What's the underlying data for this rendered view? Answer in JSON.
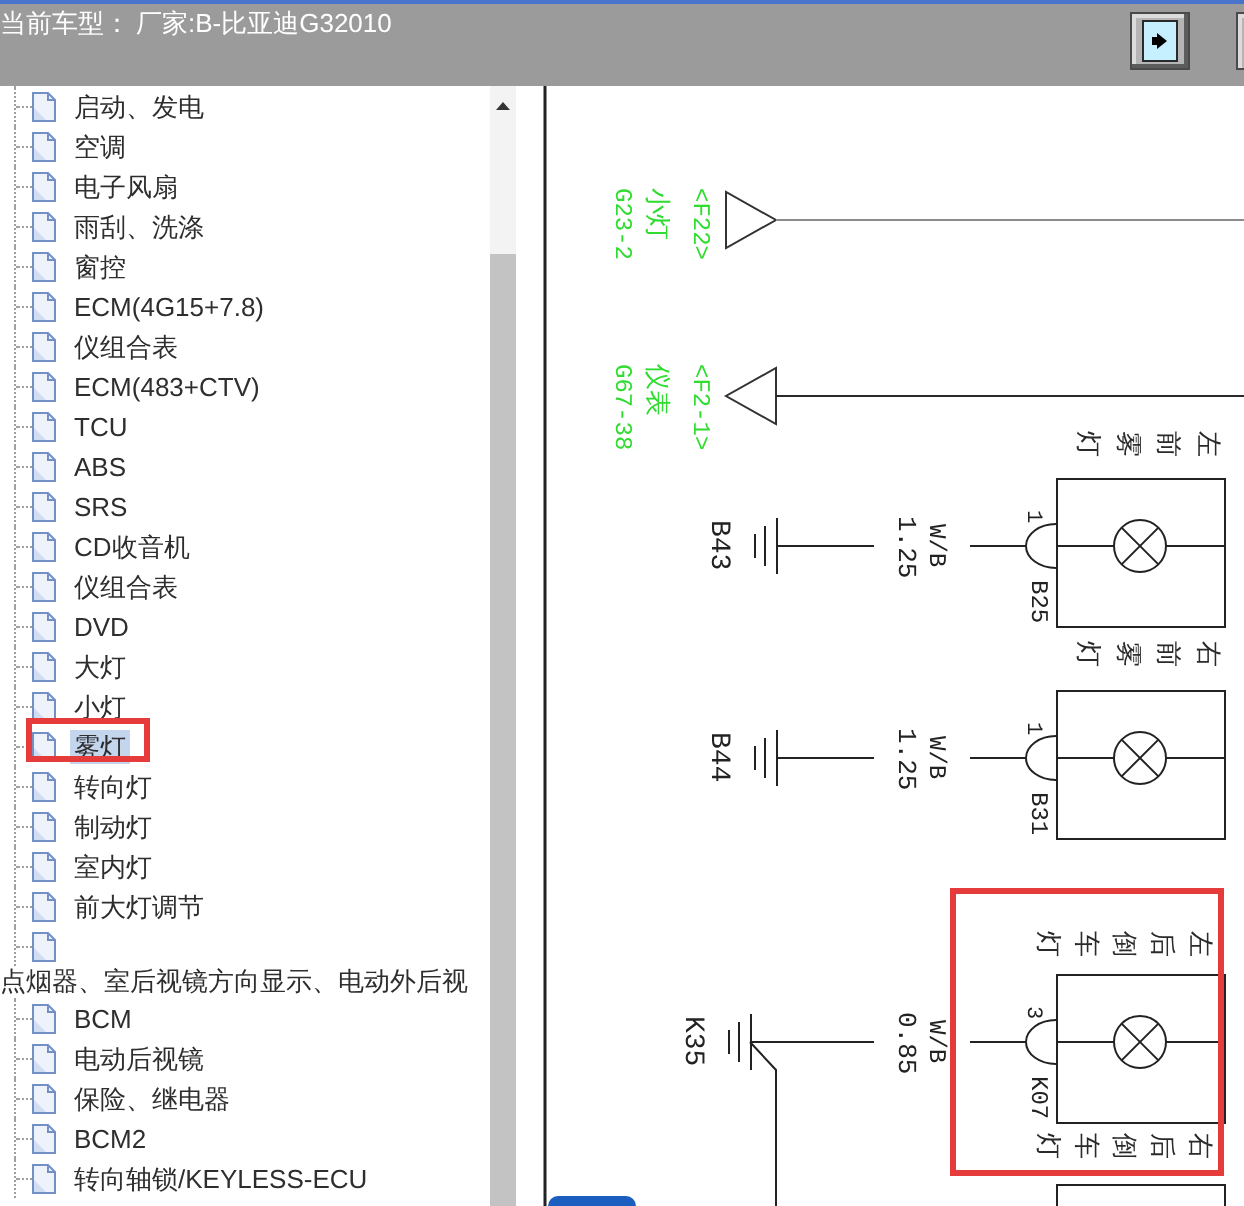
{
  "header": {
    "label": "当前车型：",
    "value": "厂家:B-比亚迪G32010"
  },
  "tree": {
    "items": [
      {
        "kind": "leaf",
        "label": "启动、发电",
        "selected": false,
        "marked": false
      },
      {
        "kind": "leaf",
        "label": "空调",
        "selected": false,
        "marked": false
      },
      {
        "kind": "leaf",
        "label": "电子风扇",
        "selected": false,
        "marked": false
      },
      {
        "kind": "leaf",
        "label": "雨刮、洗涤",
        "selected": false,
        "marked": false
      },
      {
        "kind": "leaf",
        "label": "窗控",
        "selected": false,
        "marked": false
      },
      {
        "kind": "leaf",
        "label": "ECM(4G15+7.8)",
        "selected": false,
        "marked": false
      },
      {
        "kind": "leaf",
        "label": "仪组合表",
        "selected": false,
        "marked": false
      },
      {
        "kind": "leaf",
        "label": "ECM(483+CTV)",
        "selected": false,
        "marked": false
      },
      {
        "kind": "leaf",
        "label": "TCU",
        "selected": false,
        "marked": false
      },
      {
        "kind": "leaf",
        "label": "ABS",
        "selected": false,
        "marked": false
      },
      {
        "kind": "leaf",
        "label": "SRS",
        "selected": false,
        "marked": false
      },
      {
        "kind": "leaf",
        "label": "CD收音机",
        "selected": false,
        "marked": false
      },
      {
        "kind": "leaf",
        "label": "仪组合表",
        "selected": false,
        "marked": false
      },
      {
        "kind": "leaf",
        "label": "DVD",
        "selected": false,
        "marked": false
      },
      {
        "kind": "leaf",
        "label": "大灯",
        "selected": false,
        "marked": false
      },
      {
        "kind": "leaf",
        "label": "小灯",
        "selected": false,
        "marked": false
      },
      {
        "kind": "leaf",
        "label": "雾灯",
        "selected": true,
        "marked": true
      },
      {
        "kind": "leaf",
        "label": "转向灯",
        "selected": false,
        "marked": false
      },
      {
        "kind": "leaf",
        "label": "制动灯",
        "selected": false,
        "marked": false
      },
      {
        "kind": "leaf",
        "label": "室内灯",
        "selected": false,
        "marked": false
      },
      {
        "kind": "leaf",
        "label": "前大灯调节",
        "selected": false,
        "marked": false
      },
      {
        "kind": "wrapped",
        "label": "点烟器、室后视镜方向显示、电动外后视",
        "selected": false,
        "marked": false
      },
      {
        "kind": "leaf",
        "label": "BCM",
        "selected": false,
        "marked": false
      },
      {
        "kind": "leaf",
        "label": "电动后视镜",
        "selected": false,
        "marked": false
      },
      {
        "kind": "leaf",
        "label": "保险、继电器",
        "selected": false,
        "marked": false
      },
      {
        "kind": "leaf",
        "label": "BCM2",
        "selected": false,
        "marked": false
      },
      {
        "kind": "leaf",
        "label": "转向轴锁/KEYLESS-ECU",
        "selected": false,
        "marked": false
      }
    ]
  },
  "diagram": {
    "signals": [
      {
        "kind": "out",
        "code": "<F22>",
        "name": "小灯",
        "pin": "G23-2"
      },
      {
        "kind": "in",
        "code": "<F2-1>",
        "name": "仪表",
        "pin": "G67-38"
      }
    ],
    "lamps": [
      {
        "label": "左前雾灯",
        "pin": "1",
        "connector": "B25",
        "wire_color": "W/B",
        "wire_gauge": "1.25",
        "ground": "B43",
        "ground_branch": false,
        "marked": false
      },
      {
        "label": "右前雾灯",
        "pin": "1",
        "connector": "B31",
        "wire_color": "W/B",
        "wire_gauge": "1.25",
        "ground": "B44",
        "ground_branch": false,
        "marked": false
      },
      {
        "label": "左后倒车灯",
        "pin": "3",
        "connector": "K07",
        "wire_color": "W/B",
        "wire_gauge": "0.85",
        "ground": "K35",
        "ground_branch": true,
        "marked": true
      },
      {
        "label": "右后倒车灯",
        "marked": false
      }
    ]
  }
}
